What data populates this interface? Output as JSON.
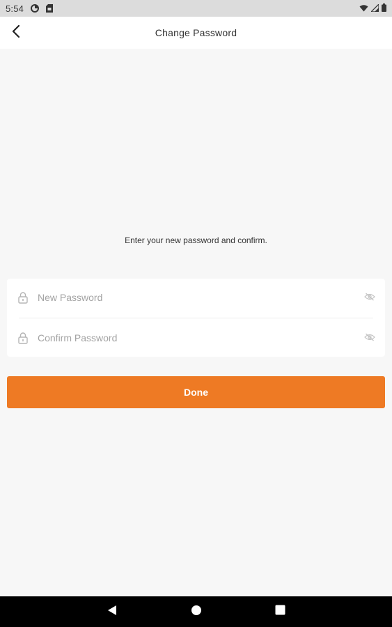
{
  "status_bar": {
    "time": "5:54",
    "icons_left": [
      "data-saver-icon",
      "sim-card-icon"
    ],
    "icons_right": [
      "wifi-icon",
      "signal-icon",
      "battery-icon"
    ]
  },
  "app_bar": {
    "title": "Change Password",
    "back_icon": "chevron-left-icon"
  },
  "instruction": "Enter your new password and confirm.",
  "form": {
    "new_password": {
      "placeholder": "New Password",
      "value": "",
      "leading_icon": "lock-icon",
      "trailing_icon": "eye-off-icon"
    },
    "confirm_password": {
      "placeholder": "Confirm Password",
      "value": "",
      "leading_icon": "lock-icon",
      "trailing_icon": "eye-off-icon"
    }
  },
  "done_button": {
    "label": "Done",
    "color": "#EE7A24"
  },
  "nav_bar": {
    "back_icon": "triangle-back-icon",
    "home_icon": "circle-home-icon",
    "recents_icon": "square-recents-icon"
  },
  "colors": {
    "accent": "#EE7A24",
    "background": "#F7F7F7",
    "surface": "#FFFFFF",
    "status_bar": "#DCDCDC",
    "nav_bar": "#000000"
  }
}
